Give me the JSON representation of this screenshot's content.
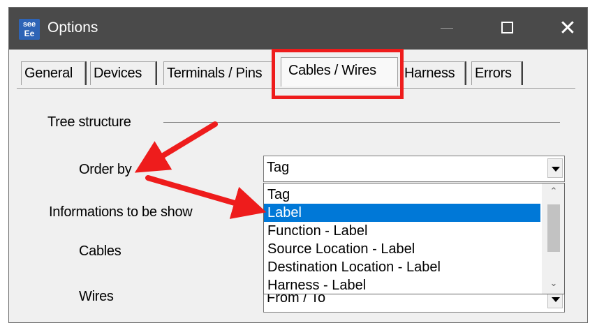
{
  "window": {
    "title": "Options",
    "app_icon_line1": "see",
    "app_icon_line2": "Ee",
    "close_glyph": "✕"
  },
  "tabs": [
    {
      "label": "General"
    },
    {
      "label": "Devices"
    },
    {
      "label": "Terminals / Pins"
    },
    {
      "label": "Cables / Wires",
      "selected": true
    },
    {
      "label": "Harness"
    },
    {
      "label": "Errors"
    }
  ],
  "panel": {
    "tree_structure_label": "Tree structure",
    "order_by_label": "Order by",
    "order_by_value": "Tag",
    "informations_label": "Informations to be show",
    "cables_label": "Cables",
    "wires_label": "Wires",
    "wires_value": "From / To"
  },
  "dropdown": {
    "options": [
      "Tag",
      "Label",
      "Function - Label",
      "Source Location - Label",
      "Destination Location - Label",
      "Harness - Label"
    ],
    "selected_index": 1
  },
  "icons": {
    "app": "app-logo-icon",
    "minimize": "minimize-icon",
    "maximize": "maximize-icon",
    "close": "close-icon",
    "combo_arrow": "chevron-down-icon",
    "scroll_up": "scroll-up-icon",
    "scroll_down": "scroll-down-icon"
  },
  "colors": {
    "titlebar": "#4a4a4a",
    "selection": "#0078d7",
    "annotation_red": "#ee1c1c"
  }
}
